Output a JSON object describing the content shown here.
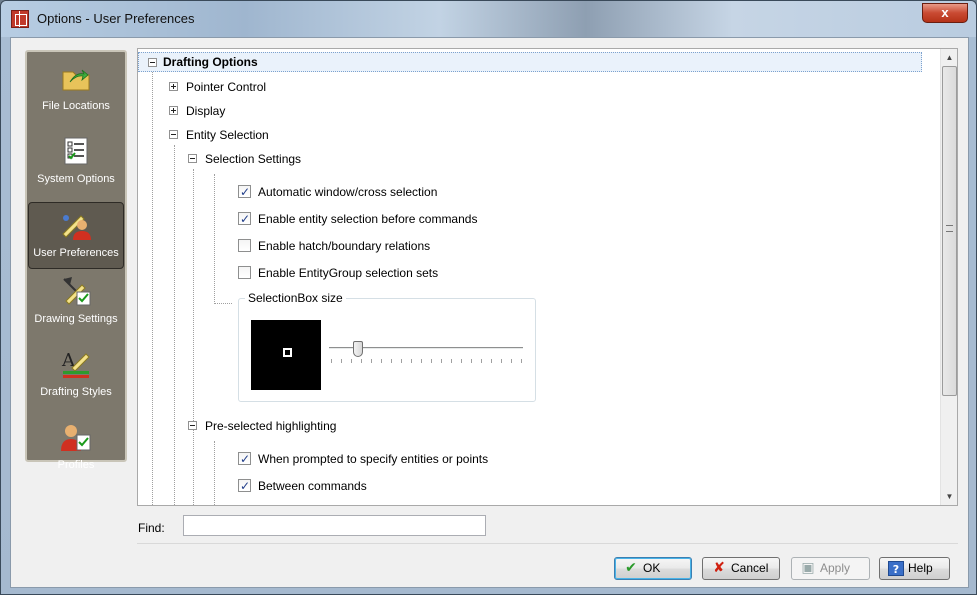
{
  "window": {
    "title": "Options - User Preferences",
    "close_glyph": "x"
  },
  "sidebar": {
    "items": [
      {
        "label": "File Locations",
        "icon": "folder-arrow-icon",
        "active": false
      },
      {
        "label": "System Options",
        "icon": "checklist-icon",
        "active": false
      },
      {
        "label": "User Preferences",
        "icon": "user-preferences-icon",
        "active": true
      },
      {
        "label": "Drawing Settings",
        "icon": "drawing-settings-icon",
        "active": false
      },
      {
        "label": "Drafting Styles",
        "icon": "drafting-styles-icon",
        "active": false
      },
      {
        "label": "Profiles",
        "icon": "profiles-icon",
        "active": false
      }
    ]
  },
  "tree": {
    "root": "Drafting Options",
    "pointer_control": "Pointer Control",
    "display": "Display",
    "entity_selection": "Entity Selection",
    "selection_settings": "Selection Settings",
    "options": [
      {
        "label": "Automatic window/cross selection",
        "checked": true
      },
      {
        "label": "Enable entity selection before commands",
        "checked": true
      },
      {
        "label": "Enable hatch/boundary relations",
        "checked": false
      },
      {
        "label": "Enable EntityGroup selection sets",
        "checked": false
      }
    ],
    "selectionbox_title": "SelectionBox size",
    "selectionbox_value": 0.15,
    "preselected": "Pre-selected highlighting",
    "preselected_options": [
      {
        "label": "When prompted to specify entities or points",
        "checked": true
      },
      {
        "label": "Between commands",
        "checked": true
      }
    ]
  },
  "find": {
    "label": "Find:",
    "value": "",
    "placeholder": ""
  },
  "buttons": {
    "ok": "OK",
    "cancel": "Cancel",
    "apply": "Apply",
    "help": "Help"
  },
  "colors": {
    "selection_highlight": "#eaf2fb",
    "sidebar_bg": "#7d786c",
    "check": "#213e8a"
  }
}
